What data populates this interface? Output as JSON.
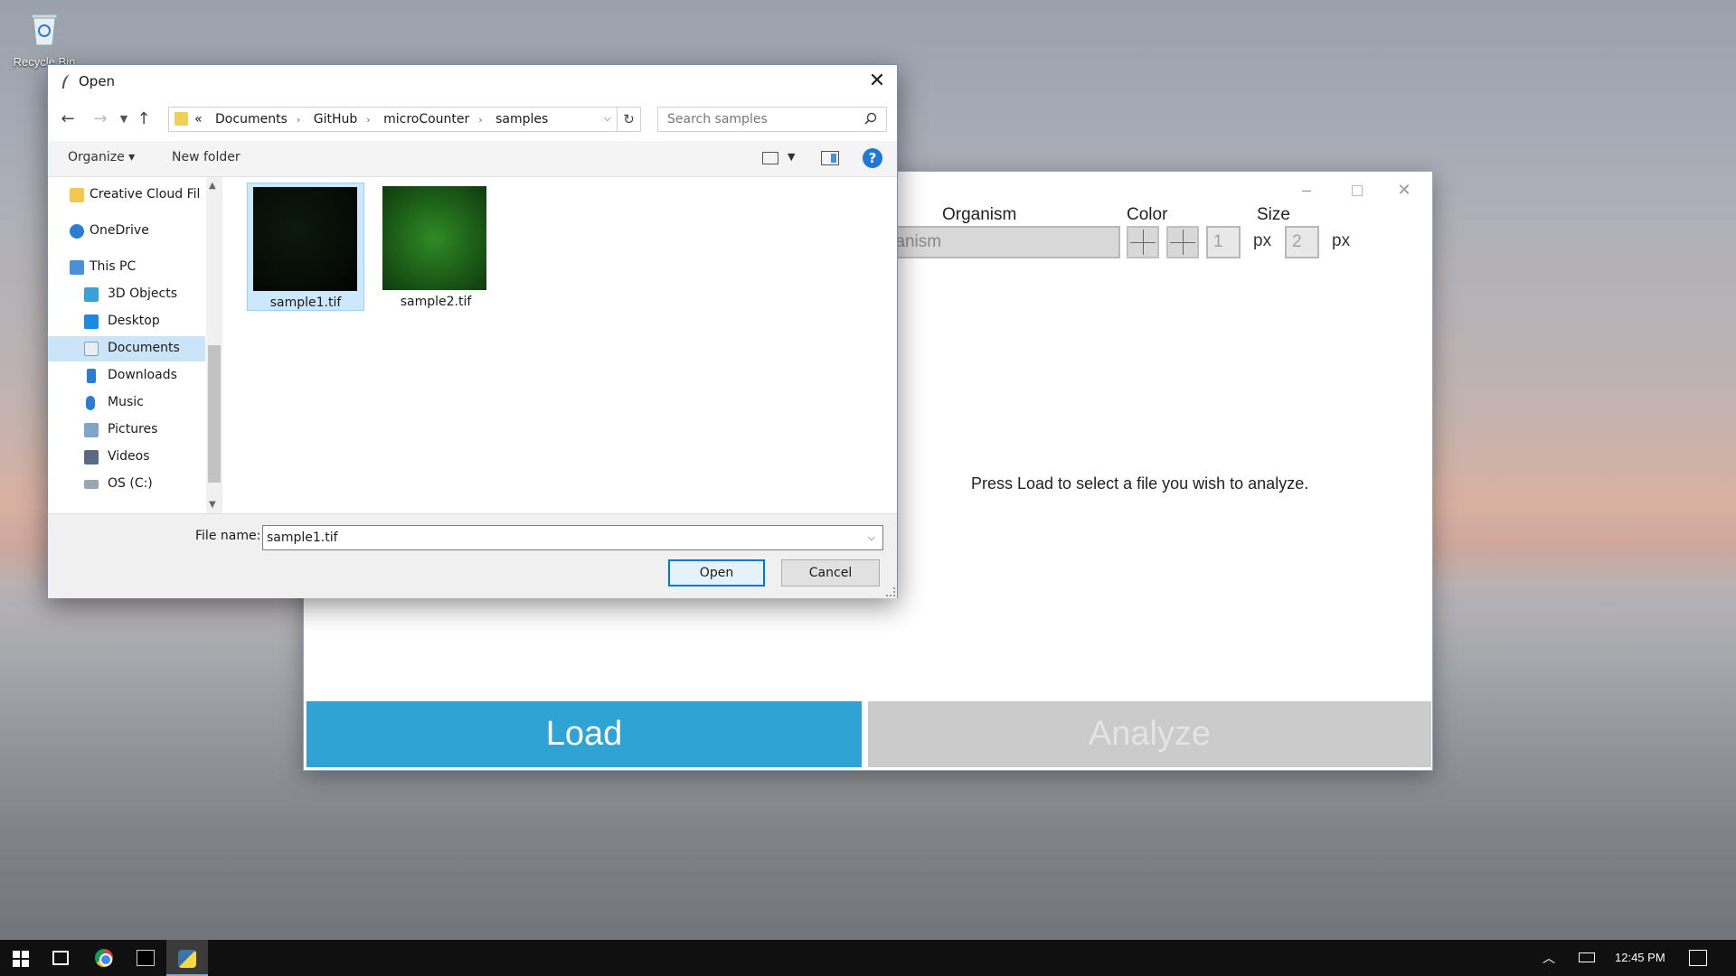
{
  "desktop": {
    "recycle_bin_label": "Recycle Bin"
  },
  "app": {
    "labels": {
      "organism": "Organism",
      "color": "Color",
      "size": "Size"
    },
    "organism_value": "wOrganism",
    "size_min": "1",
    "size_max": "2",
    "unit": "px",
    "message": "Press Load to select a file you wish to analyze.",
    "load_label": "Load",
    "analyze_label": "Analyze",
    "colors": {
      "load_bg": "#2fa4d4",
      "analyze_bg": "#cbcbcb"
    }
  },
  "dialog": {
    "title": "Open",
    "breadcrumb_prefix": "«",
    "breadcrumb": [
      "Documents",
      "GitHub",
      "microCounter",
      "samples"
    ],
    "search_placeholder": "Search samples",
    "toolbar": {
      "organize": "Organize ▾",
      "new_folder": "New folder",
      "help": "?"
    },
    "nav_items": [
      {
        "label": "Creative Cloud Fil",
        "icon": "creative-cloud-icon"
      },
      {
        "label": "OneDrive",
        "icon": "onedrive-icon"
      },
      {
        "label": "This PC",
        "icon": "computer-icon"
      },
      {
        "label": "3D Objects",
        "icon": "cube-icon"
      },
      {
        "label": "Desktop",
        "icon": "desktop-icon"
      },
      {
        "label": "Documents",
        "icon": "document-icon"
      },
      {
        "label": "Downloads",
        "icon": "download-icon"
      },
      {
        "label": "Music",
        "icon": "music-icon"
      },
      {
        "label": "Pictures",
        "icon": "pictures-icon"
      },
      {
        "label": "Videos",
        "icon": "videos-icon"
      },
      {
        "label": "OS (C:)",
        "icon": "drive-icon"
      }
    ],
    "files": [
      {
        "name": "sample1.tif",
        "selected": true,
        "thumb_color": "#050a05"
      },
      {
        "name": "sample2.tif",
        "selected": false,
        "thumb_color": "#1f6a1a"
      }
    ],
    "file_name_label": "File name:",
    "file_name_value": "sample1.tif",
    "open_label": "Open",
    "cancel_label": "Cancel"
  },
  "taskbar": {
    "clock": "12:45 PM"
  }
}
